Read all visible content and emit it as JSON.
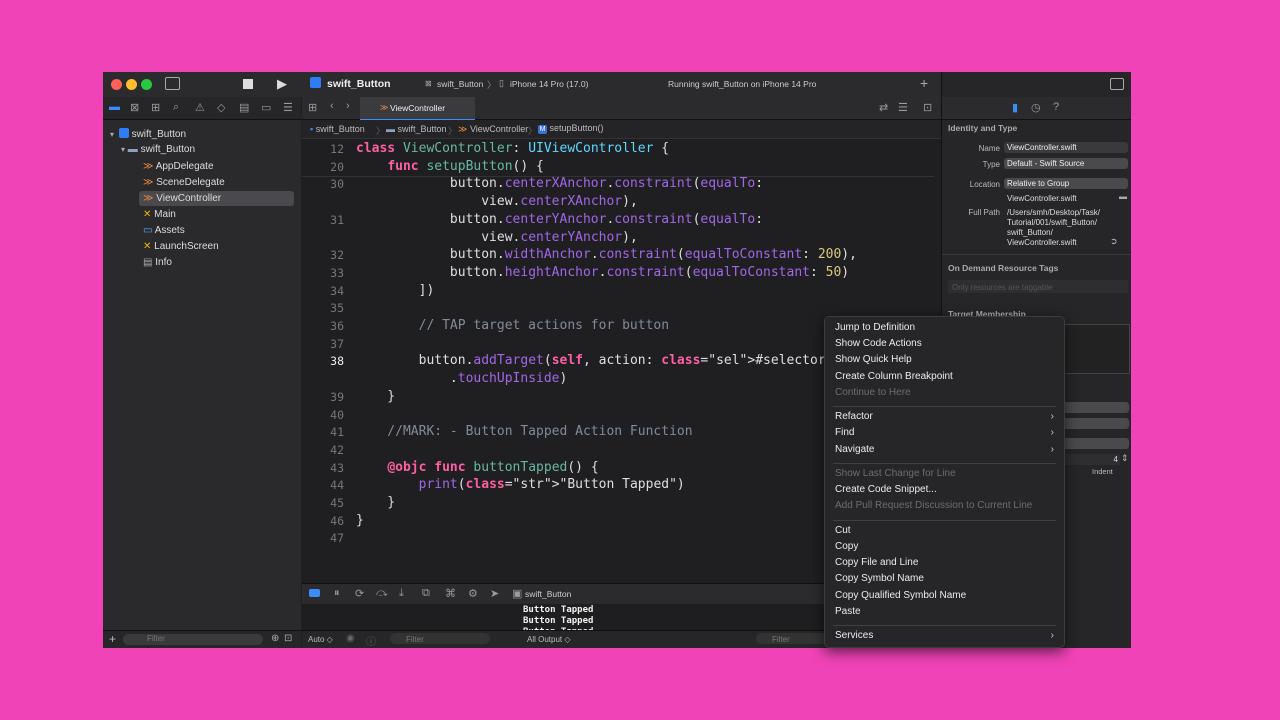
{
  "project": "swift_Button",
  "scheme": "swift_Button",
  "device": "iPhone 14 Pro (17.0)",
  "status": "Running swift_Button on iPhone 14 Pro",
  "editor_tab": "ViewController",
  "breadcrumb": [
    "swift_Button",
    "swift_Button",
    "ViewController",
    "setupButton()"
  ],
  "navigator": {
    "root": "swift_Button",
    "group": "swift_Button",
    "files": [
      "AppDelegate",
      "SceneDelegate",
      "ViewController",
      "Main",
      "Assets",
      "LaunchScreen",
      "Info"
    ],
    "filter_placeholder": "Filter"
  },
  "code_lines": [
    {
      "n": "12",
      "t": "class ViewController: UIViewController {"
    },
    {
      "n": "20",
      "t": "    func setupButton() {"
    },
    {
      "n": "30",
      "t": "            button.centerXAnchor.constraint(equalTo:"
    },
    {
      "n": "",
      "t": "                view.centerXAnchor),"
    },
    {
      "n": "31",
      "t": "            button.centerYAnchor.constraint(equalTo:"
    },
    {
      "n": "",
      "t": "                view.centerYAnchor),"
    },
    {
      "n": "32",
      "t": "            button.widthAnchor.constraint(equalToConstant: 200),"
    },
    {
      "n": "33",
      "t": "            button.heightAnchor.constraint(equalToConstant: 50)"
    },
    {
      "n": "34",
      "t": "        ])"
    },
    {
      "n": "35",
      "t": ""
    },
    {
      "n": "36",
      "t": "        // TAP target actions for button"
    },
    {
      "n": "37",
      "t": ""
    },
    {
      "n": "38",
      "t": "        button.addTarget(self, action: #selector(buttonTa"
    },
    {
      "n": "",
      "t": "            .touchUpInside)"
    },
    {
      "n": "39",
      "t": "    }"
    },
    {
      "n": "40",
      "t": ""
    },
    {
      "n": "41",
      "t": "    //MARK: - Button Tapped Action Function"
    },
    {
      "n": "42",
      "t": ""
    },
    {
      "n": "43",
      "t": "    @objc func buttonTapped() {"
    },
    {
      "n": "44",
      "t": "        print(\"Button Tapped\")"
    },
    {
      "n": "45",
      "t": "    }"
    },
    {
      "n": "46",
      "t": "}"
    },
    {
      "n": "47",
      "t": ""
    }
  ],
  "debug_target": "swift_Button",
  "console_output": [
    "Button Tapped",
    "Button Tapped",
    "Button Tapped",
    "Button Tapped",
    "Button Tapped",
    "Button Tapped"
  ],
  "console_footer": {
    "auto": "Auto ◇",
    "filter": "Filter",
    "all_output": "All Output ◇"
  },
  "inspector": {
    "section_identity": "Identity and Type",
    "name_label": "Name",
    "name_value": "ViewController.swift",
    "type_label": "Type",
    "type_value": "Default - Swift Source",
    "location_label": "Location",
    "location_value": "Relative to Group",
    "location_file": "ViewController.swift",
    "fullpath_label": "Full Path",
    "fullpath_value": [
      "/Users/smh/Desktop/Task/",
      "Tutorial/001/swift_Button/",
      "swift_Button/",
      "ViewController.swift"
    ],
    "section_tags": "On Demand Resource Tags",
    "tags_placeholder": "Only resources are taggable",
    "section_membership": "Target Membership",
    "indent_value": "4",
    "indent_label": "Indent"
  },
  "context_menu": {
    "groups": [
      [
        {
          "label": "Jump to Definition"
        },
        {
          "label": "Show Code Actions"
        },
        {
          "label": "Show Quick Help"
        },
        {
          "label": "Create Column Breakpoint"
        },
        {
          "label": "Continue to Here",
          "disabled": true
        }
      ],
      [
        {
          "label": "Refactor",
          "sub": true
        },
        {
          "label": "Find",
          "sub": true
        },
        {
          "label": "Navigate",
          "sub": true
        }
      ],
      [
        {
          "label": "Show Last Change for Line",
          "disabled": true
        },
        {
          "label": "Create Code Snippet..."
        },
        {
          "label": "Add Pull Request Discussion to Current Line",
          "disabled": true
        }
      ],
      [
        {
          "label": "Cut"
        },
        {
          "label": "Copy"
        },
        {
          "label": "Copy File and Line"
        },
        {
          "label": "Copy Symbol Name"
        },
        {
          "label": "Copy Qualified Symbol Name"
        },
        {
          "label": "Paste"
        }
      ],
      [
        {
          "label": "Services",
          "sub": true
        }
      ]
    ]
  },
  "colors": {
    "background": "#f043b7",
    "keyword": "#fc5fa3",
    "type": "#d0a8ff"
  }
}
